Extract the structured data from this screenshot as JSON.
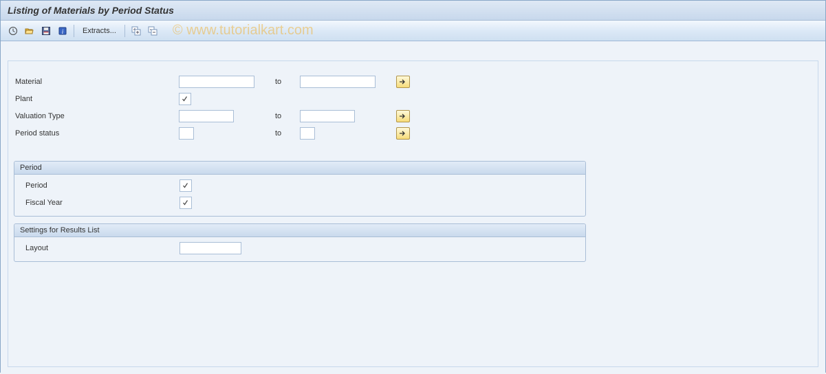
{
  "title": "Listing of Materials by Period Status",
  "watermark": "© www.tutorialkart.com",
  "toolbar": {
    "extracts_label": "Extracts..."
  },
  "criteria": {
    "material": {
      "label": "Material",
      "from": "",
      "to_label": "to",
      "to": ""
    },
    "plant": {
      "label": "Plant",
      "required": true
    },
    "valuation_type": {
      "label": "Valuation Type",
      "from": "",
      "to_label": "to",
      "to": ""
    },
    "period_status": {
      "label": "Period status",
      "from": "",
      "to_label": "to",
      "to": ""
    }
  },
  "group_period": {
    "title": "Period",
    "period": {
      "label": "Period",
      "required": true
    },
    "fiscal_year": {
      "label": "Fiscal Year",
      "required": true
    }
  },
  "group_settings": {
    "title": "Settings for Results List",
    "layout": {
      "label": "Layout",
      "value": ""
    }
  }
}
